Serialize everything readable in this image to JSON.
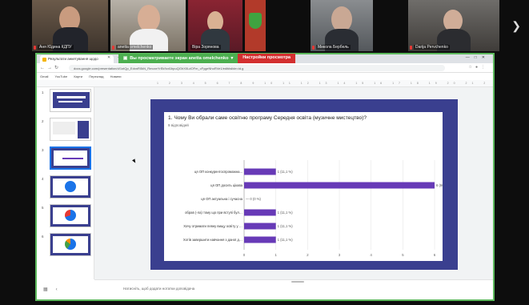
{
  "participants": [
    {
      "name": "Аня Юдина КДПУ",
      "muted": true
    },
    {
      "name": "anetta omelchenko",
      "muted": true
    },
    {
      "name": "Віра Зорянова",
      "muted": false
    },
    {
      "name": "",
      "muted": false
    },
    {
      "name": "Микола Бербель",
      "muted": true
    },
    {
      "name": "Darija Pervchenko",
      "muted": true
    }
  ],
  "share_bar": {
    "viewing_label": "Вы просматриваете экран  anetta omelchenko",
    "options_label": "Настройки просмотра"
  },
  "browser": {
    "tab_title": "Результати анкетування щодо",
    "url": "docs.google.com/presentation/d/1otQp_EdxnR0kN_RmcxeYrEk9vd1bpuQGhX0LdOFm_cFygeNhoRVe1/edit#slide=id.g",
    "bookmarks": [
      "Gmail",
      "YouTube",
      "Карти",
      "Переклад",
      "Новини"
    ]
  },
  "slides": {
    "thumbnails": [
      {
        "num": "1"
      },
      {
        "num": "2"
      },
      {
        "num": "3"
      },
      {
        "num": "4"
      },
      {
        "num": "5"
      },
      {
        "num": "6"
      }
    ],
    "selected_index": 2,
    "notes_placeholder": "Натисніть, щоб додати нотатки доповідача"
  },
  "main_slide": {
    "question": "1. Чому Ви обрали саме освітню програму Середня освіта (музичне мистецтво)?",
    "responses": "9 відповідей"
  },
  "chart_data": {
    "type": "bar",
    "orientation": "horizontal",
    "categories": [
      "ця ОП конкурентоспроможна...",
      "ця ОП досить цікава",
      "ця ОП актуальна і сучасна",
      "обрав (-ла) тому що при вступі були бюджетні місця",
      "Хочу отримати певну вищу освіту у цієї спеціальності д...",
      "Хотів завершити навчання з даної дисципліни"
    ],
    "values": [
      1,
      6,
      0,
      1,
      1,
      1
    ],
    "value_labels": [
      "1 (11,1 %)",
      "6 (66,7 %)",
      "0 (0 %)",
      "1 (11,1 %)",
      "1 (11,1 %)",
      "1 (11,1 %)"
    ],
    "xlim": [
      0,
      6
    ],
    "x_ticks": [
      "0",
      "1",
      "2",
      "3",
      "4",
      "5",
      "6"
    ],
    "color": "#673ab7",
    "grid": true
  }
}
